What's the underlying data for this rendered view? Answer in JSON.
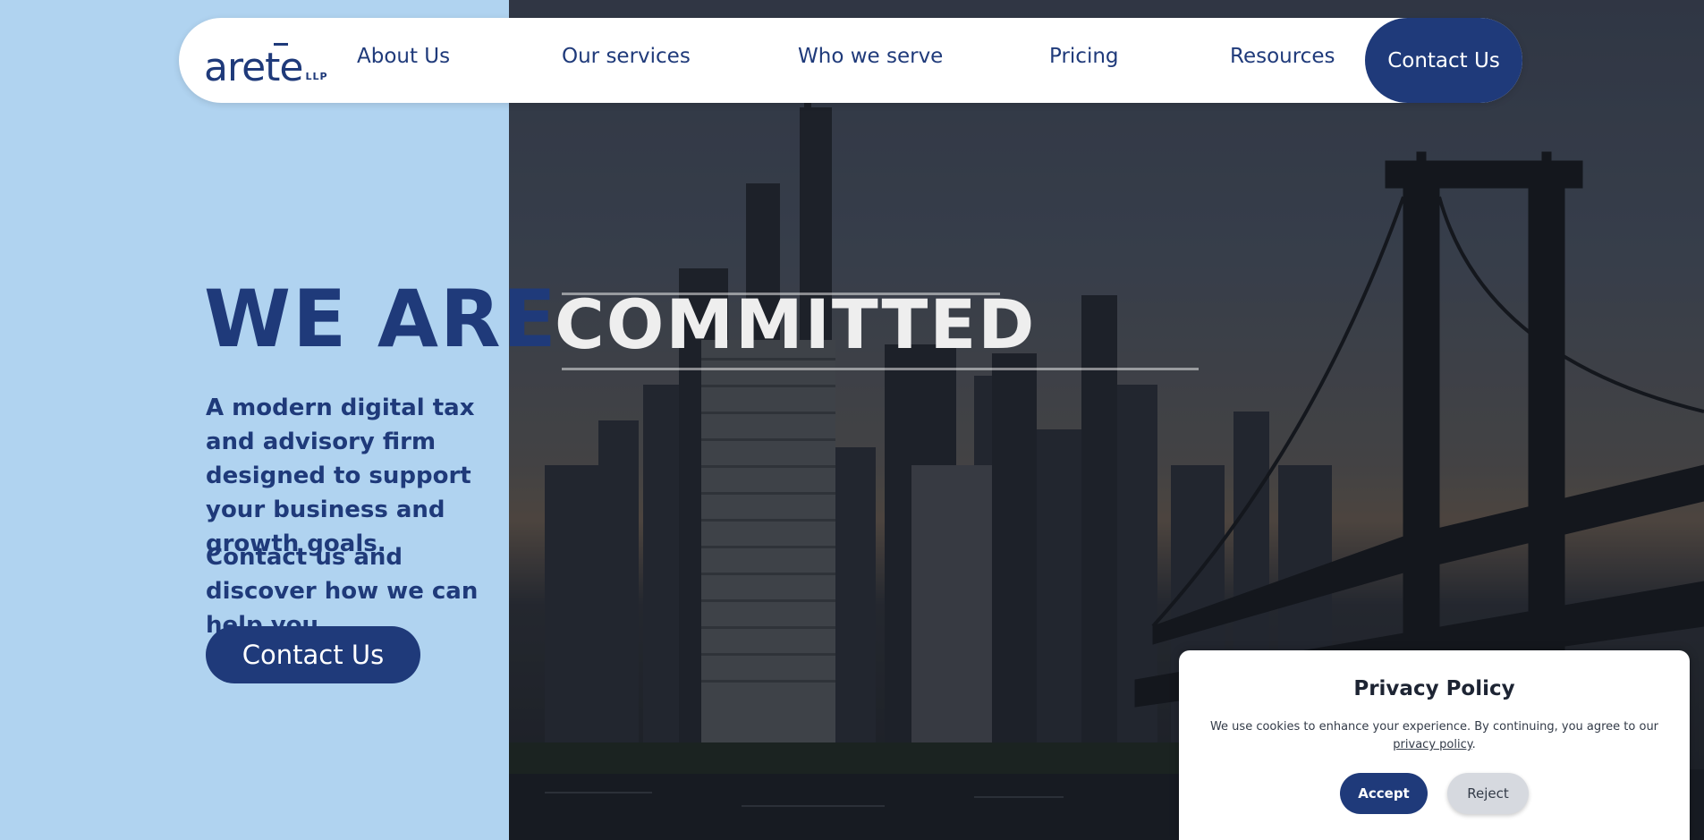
{
  "brand": {
    "logo_text": "arete",
    "logo_suffix": "LLP",
    "primary_color": "#1f3a7a",
    "background_color": "#b0d3f0"
  },
  "nav": {
    "items": [
      {
        "label": "About Us"
      },
      {
        "label": "Our services"
      },
      {
        "label": "Who we serve"
      },
      {
        "label": "Pricing"
      },
      {
        "label": "Resources"
      }
    ],
    "contact_label": "Contact Us"
  },
  "hero": {
    "heading_static": "WE ARE",
    "heading_rotating": "COMMITTED",
    "description": "A modern digital tax and advisory firm designed to support your business and growth goals.",
    "cta_text": "Contact us and discover how we can help you.",
    "cta_button": "Contact Us"
  },
  "privacy": {
    "title": "Privacy Policy",
    "text_before": "We use cookies to enhance your experience. By continuing, you agree to our ",
    "link_text": "privacy policy",
    "text_after": ".",
    "accept_label": "Accept",
    "reject_label": "Reject"
  }
}
